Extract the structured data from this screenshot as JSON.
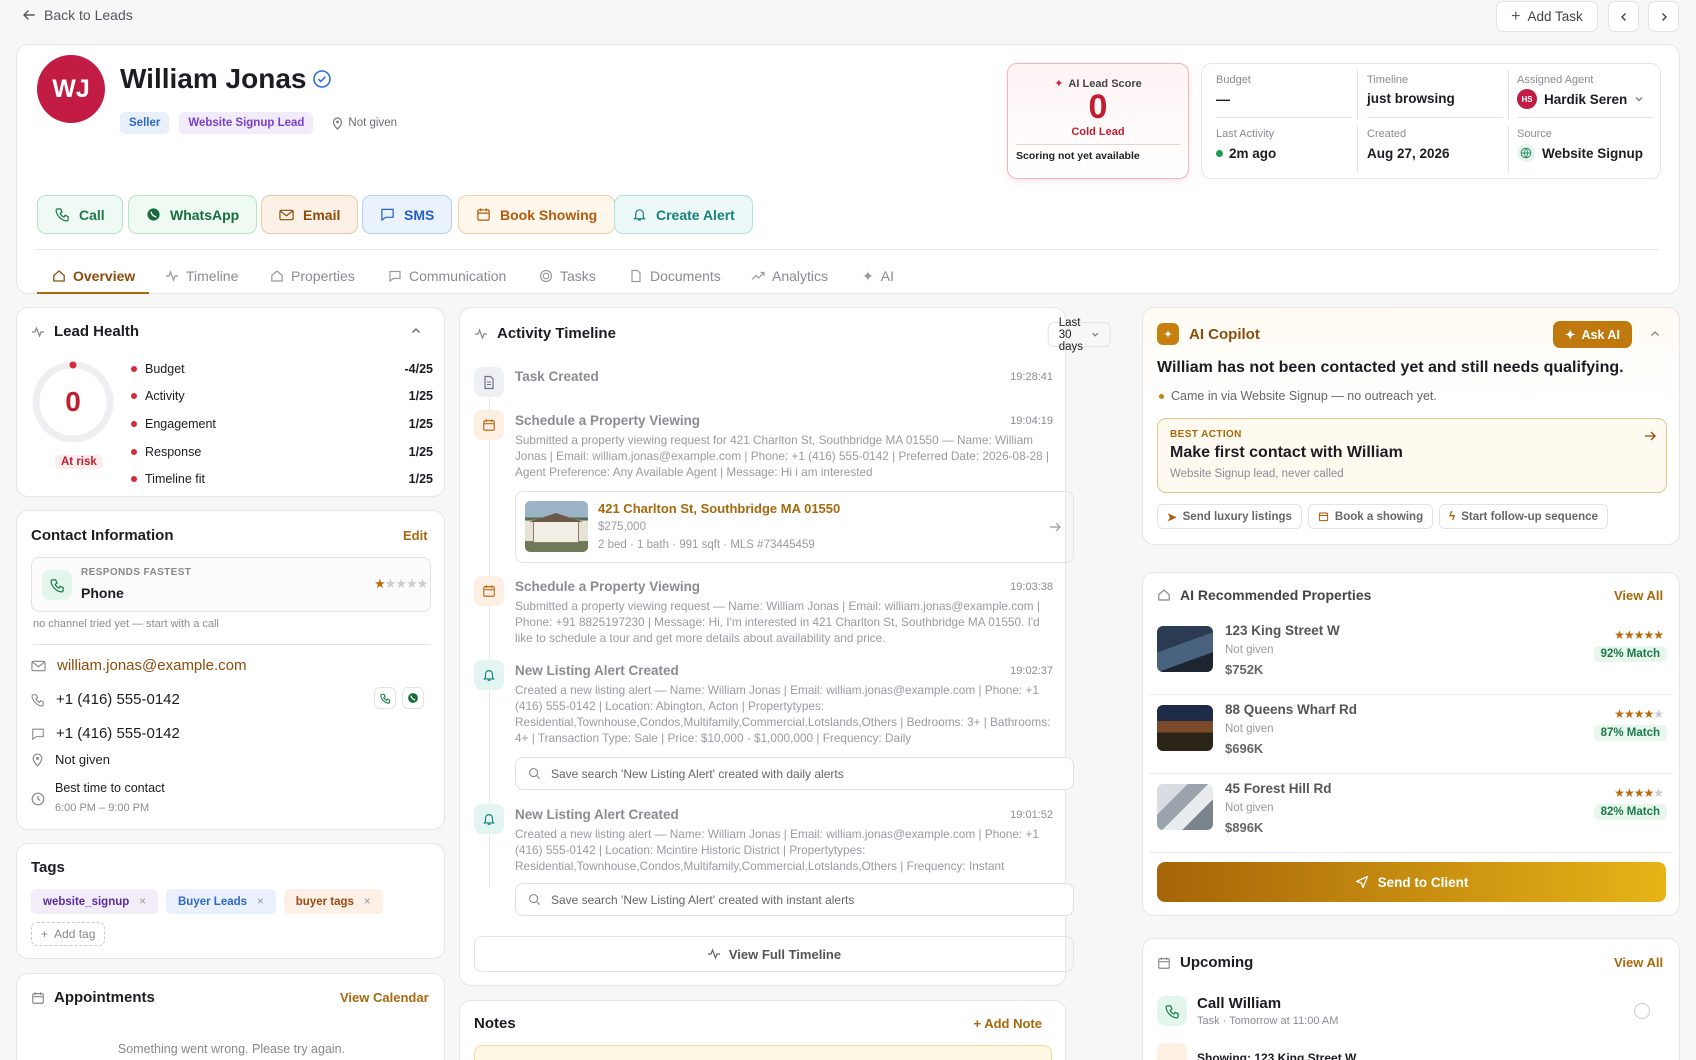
{
  "top": {
    "back": "Back to Leads",
    "add_task": "Add Task"
  },
  "lead": {
    "initials": "WJ",
    "name": "William Jonas",
    "badge_seller": "Seller",
    "badge_source": "Website Signup Lead",
    "location": "Not given"
  },
  "score": {
    "label": "AI Lead Score",
    "value": "0",
    "status": "Cold Lead",
    "note": "Scoring not yet available"
  },
  "info": {
    "budget_k": "Budget",
    "budget_v": "—",
    "timeline_k": "Timeline",
    "timeline_v": "just browsing",
    "agent_k": "Assigned Agent",
    "agent_initials": "HS",
    "agent_v": "Hardik Seren",
    "last_k": "Last Activity",
    "last_v": "2m ago",
    "created_k": "Created",
    "created_v": "Aug 27, 2026",
    "source_k": "Source",
    "source_v": "Website Signup"
  },
  "actions": {
    "call": "Call",
    "whatsapp": "WhatsApp",
    "email": "Email",
    "sms": "SMS",
    "showing": "Book Showing",
    "alert": "Create Alert"
  },
  "tabs": [
    "Overview",
    "Timeline",
    "Properties",
    "Communication",
    "Tasks",
    "Documents",
    "Analytics",
    "AI"
  ],
  "health": {
    "title": "Lead Health",
    "score": "0",
    "status": "At risk",
    "rows": [
      {
        "label": "Budget",
        "value": "-4/25"
      },
      {
        "label": "Activity",
        "value": "1/25"
      },
      {
        "label": "Engagement",
        "value": "1/25"
      },
      {
        "label": "Response",
        "value": "1/25"
      },
      {
        "label": "Timeline fit",
        "value": "1/25"
      }
    ]
  },
  "contact": {
    "title": "Contact Information",
    "edit": "Edit",
    "fastest_k": "RESPONDS FASTEST",
    "fastest_v": "Phone",
    "rating": 1,
    "hint": "no channel tried yet — start with a call",
    "email": "william.jonas@example.com",
    "phone": "+1 (416) 555-0142",
    "sms": "+1 (416) 555-0142",
    "location": "Not given",
    "best_k": "Best time to contact",
    "best_v": "6:00 PM – 9:00 PM"
  },
  "tags": {
    "title": "Tags",
    "items": [
      "website_signup",
      "Buyer Leads",
      "buyer tags"
    ],
    "add": "Add tag"
  },
  "appointments": {
    "title": "Appointments",
    "link": "View Calendar",
    "error": "Something went wrong. Please try again."
  },
  "activity": {
    "title": "Activity Timeline",
    "range": "Last 30 days",
    "items": [
      {
        "title": "Task Created",
        "time": "19:28:41"
      },
      {
        "title": "Schedule a Property Viewing",
        "time": "19:04:19",
        "body": "Submitted a property viewing request for 421 Charlton St, Southbridge MA 01550 — Name: William Jonas | Email: william.jonas@example.com | Phone: +1 (416) 555-0142 | Preferred Date: 2026-08-28 | Agent Preference: Any Available Agent | Message: Hi i am interested"
      },
      {
        "title": "Schedule a Property Viewing",
        "time": "19:03:38",
        "body": "Submitted a property viewing request — Name: William Jonas | Email: william.jonas@example.com | Phone: +91 8825197230 | Message: Hi, I'm interested in 421 Charlton St, Southbridge MA 01550. I'd like to schedule a tour and get more details about availability and price."
      },
      {
        "title": "New Listing Alert Created",
        "time": "19:02:37",
        "body": "Created a new listing alert — Name: William Jonas | Email: william.jonas@example.com | Phone: +1 (416) 555-0142 | Location: Abington, Acton | Propertytypes: Residential,Townhouse,Condos,Multifamily,Commercial,Lotslands,Others | Bedrooms: 3+ | Bathrooms: 4+ | Transaction Type: Sale | Price: $10,000 - $1,000,000 | Frequency: Daily",
        "search": "Save search 'New Listing Alert' created with daily alerts"
      },
      {
        "title": "New Listing Alert Created",
        "time": "19:01:52",
        "body": "Created a new listing alert — Name: William Jonas | Email: william.jonas@example.com | Phone: +1 (416) 555-0142 | Location: Mcintire Historic District | Propertytypes: Residential,Townhouse,Condos,Multifamily,Commercial,Lotslands,Others | Frequency: Instant",
        "search": "Save search 'New Listing Alert' created with instant alerts"
      }
    ],
    "property": {
      "address": "421 Charlton St, Southbridge MA 01550",
      "price": "$275,000",
      "meta": "2 bed · 1 bath · 991 sqft · MLS #73445459"
    },
    "view_full": "View Full Timeline"
  },
  "notes": {
    "title": "Notes",
    "add": "+ Add Note"
  },
  "copilot": {
    "title": "AI Copilot",
    "ask": "Ask AI",
    "headline": "William has not been contacted yet and still needs qualifying.",
    "bullet": "Came in via Website Signup — no outreach yet.",
    "best_k": "BEST ACTION",
    "best_title": "Make first contact with William",
    "best_sub": "Website Signup lead, never called",
    "chips": [
      "Send luxury listings",
      "Book a showing",
      "Start follow-up sequence"
    ]
  },
  "recommended": {
    "title": "AI Recommended Properties",
    "link": "View All",
    "items": [
      {
        "address": "123 King Street W",
        "loc": "Not given",
        "price": "$752K",
        "stars": 5,
        "match": "92% Match"
      },
      {
        "address": "88 Queens Wharf Rd",
        "loc": "Not given",
        "price": "$696K",
        "stars": 4,
        "match": "87% Match"
      },
      {
        "address": "45 Forest Hill Rd",
        "loc": "Not given",
        "price": "$896K",
        "stars": 4,
        "match": "82% Match"
      }
    ],
    "send": "Send to Client"
  },
  "upcoming": {
    "title": "Upcoming",
    "link": "View All",
    "items": [
      {
        "title": "Call William",
        "sub": "Task · Tomorrow at 11:00 AM"
      },
      {
        "title": "Showing: 123 King Street W"
      }
    ]
  }
}
